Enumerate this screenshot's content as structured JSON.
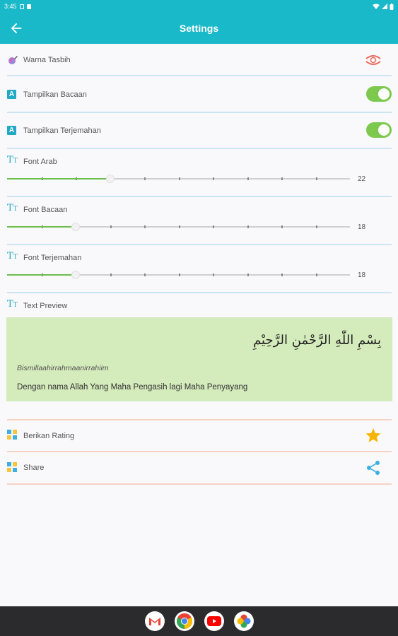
{
  "statusbar": {
    "time": "3:45"
  },
  "appbar": {
    "title": "Settings"
  },
  "settings": {
    "warna_tasbih": {
      "label": "Warna Tasbih"
    },
    "tampilkan_bacaan": {
      "label": "Tampilkan Bacaan",
      "enabled": true
    },
    "tampilkan_terjemahan": {
      "label": "Tampilkan Terjemahan",
      "enabled": true
    },
    "font_arab": {
      "label": "Font Arab",
      "value": "22",
      "fill_fraction": 0.3
    },
    "font_bacaan": {
      "label": "Font Bacaan",
      "value": "18",
      "fill_fraction": 0.2
    },
    "font_terjemahan": {
      "label": "Font Terjemahan",
      "value": "18",
      "fill_fraction": 0.2
    },
    "text_preview": {
      "label": "Text Preview"
    }
  },
  "preview": {
    "arabic": "بِسْمِ اللّٰهِ الرَّحْمٰنِ الرَّحِيْمِ",
    "latin": "Bismillaahirrahmaanirrahiim",
    "translation": "Dengan nama Allah Yang Maha Pengasih lagi Maha Penyayang"
  },
  "actions": {
    "rating": {
      "label": "Berikan Rating"
    },
    "share": {
      "label": "Share"
    }
  },
  "colors": {
    "primary": "#1ab9c9",
    "toggle_on": "#7cc94e",
    "preview_bg": "#d4ebbb",
    "star": "#f7b500"
  },
  "dock": {
    "apps": [
      "gmail-icon",
      "chrome-icon",
      "youtube-icon",
      "photos-icon"
    ]
  }
}
